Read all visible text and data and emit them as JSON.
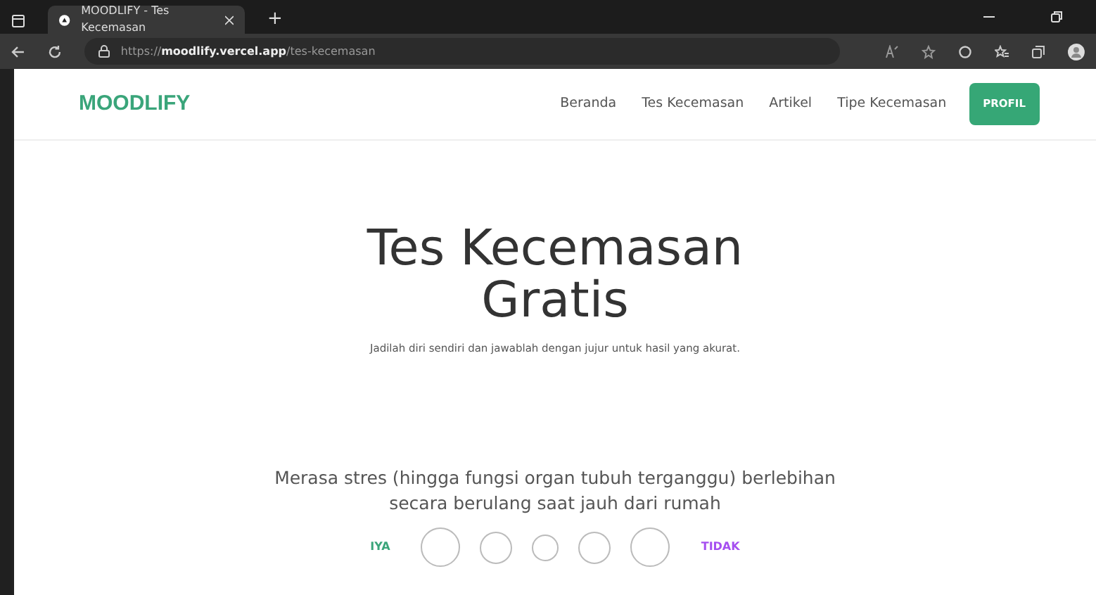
{
  "browser": {
    "tab_title": "MOODLIFY - Tes Kecemasan",
    "new_tab": "+",
    "url": "https://**moodlify.vercel.app**/tes-kecemasan"
  },
  "navbar": {
    "brand": "MOODLIFY",
    "links": [
      {
        "label": "Beranda"
      },
      {
        "label": "Tes Kecemasan"
      },
      {
        "label": "Artikel"
      },
      {
        "label": "Tipe Kecemasan"
      }
    ],
    "button": "PROFIL"
  },
  "hero": {
    "title": "Tes Kecemasan Gratis",
    "subtitle": "Jadilah diri sendiri dan jawablah dengan jujur untuk hasil yang akurat."
  },
  "question": {
    "text": "Merasa stres (hingga fungsi organ tubuh terganggu) berlebihan secara berulang saat jauh dari rumah",
    "agree_label": "IYA",
    "disagree_label": "TIDAK",
    "options": [
      {
        "kind": "large",
        "selected": false
      },
      {
        "kind": "medium",
        "selected": false
      },
      {
        "kind": "small",
        "selected": false
      },
      {
        "kind": "medium",
        "selected": false
      },
      {
        "kind": "large",
        "selected": false
      }
    ]
  }
}
